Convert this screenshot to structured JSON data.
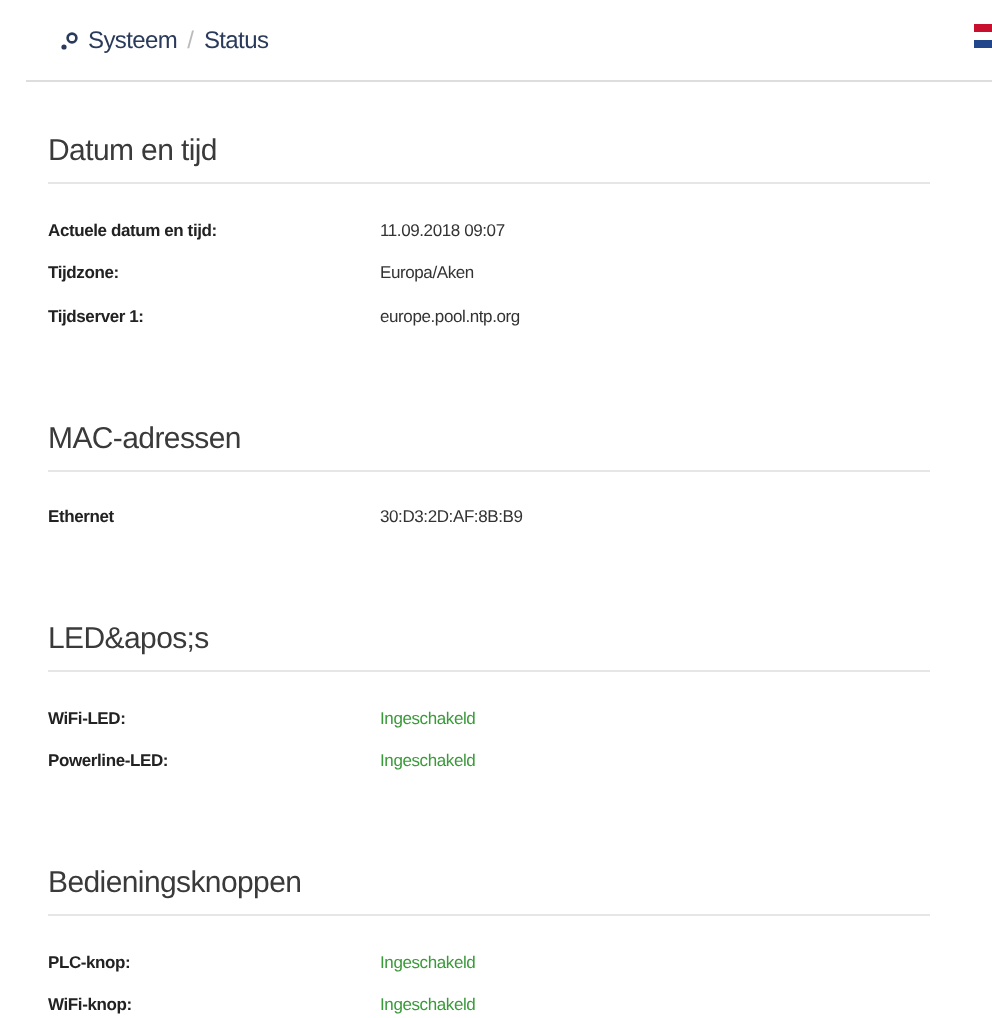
{
  "breadcrumb": [
    "Systeem",
    "Status"
  ],
  "breadcrumb_separator": "/",
  "sections": [
    {
      "title": "Datum en tijd",
      "rows": [
        {
          "label": "Actuele datum en tijd:",
          "value": "11.09.2018 09:07",
          "kind": "text"
        },
        {
          "label": "Tijdzone:",
          "value": "Europa/Aken",
          "kind": "text"
        },
        {
          "label": "Tijdserver 1:",
          "value": "europe.pool.ntp.org",
          "kind": "text"
        }
      ]
    },
    {
      "title": "MAC-adressen",
      "rows": [
        {
          "label": "Ethernet",
          "value": "30:D3:2D:AF:8B:B9",
          "kind": "text"
        }
      ]
    },
    {
      "title": "LED&apos;s",
      "rows": [
        {
          "label": "WiFi-LED:",
          "value": "Ingeschakeld",
          "kind": "status"
        },
        {
          "label": "Powerline-LED:",
          "value": "Ingeschakeld",
          "kind": "status"
        }
      ]
    },
    {
      "title": "Bedieningsknoppen",
      "rows": [
        {
          "label": "PLC-knop:",
          "value": "Ingeschakeld",
          "kind": "status"
        },
        {
          "label": "WiFi-knop:",
          "value": "Ingeschakeld",
          "kind": "status"
        }
      ]
    }
  ]
}
